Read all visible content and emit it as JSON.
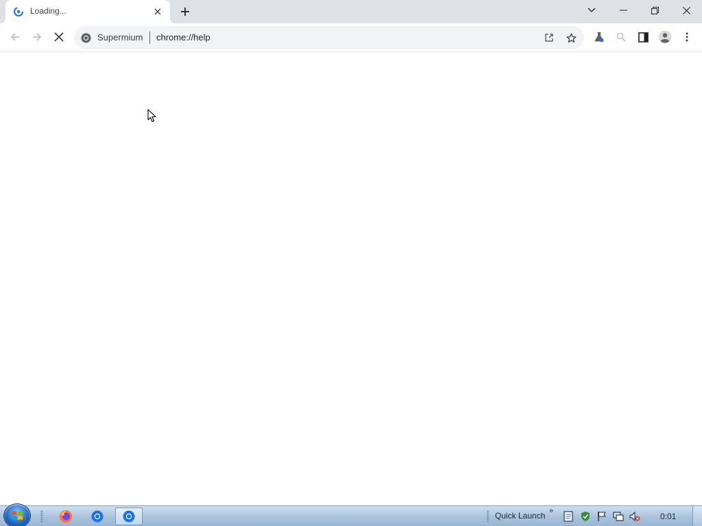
{
  "browser": {
    "tab": {
      "title": "Loading...",
      "favicon": "chromium-loading-icon",
      "close_icon": "close-icon"
    },
    "new_tab_icon": "plus-icon",
    "window_controls": [
      "chevron-down-icon",
      "minimize-icon",
      "restore-icon",
      "close-icon"
    ],
    "toolbar": {
      "back_icon": "arrow-left-icon",
      "forward_icon": "arrow-right-icon",
      "stop_icon": "stop-loading-icon"
    },
    "omnibox": {
      "site_chip": "Supermium",
      "url": "chrome://help",
      "actions": [
        "share-icon",
        "bookmark-star-icon"
      ]
    },
    "extensions": [
      "labs-flask-icon",
      "search-icon",
      "side-panel-icon",
      "profile-icon",
      "menu-kebab-icon"
    ]
  },
  "taskbar": {
    "start_icon": "windows-orb-icon",
    "apps": [
      "firefox-icon",
      "chrome-icon",
      "chrome-icon"
    ],
    "quick_launch_label": "Quick Launch",
    "quick_launch_chevron": "»",
    "tray_icons": [
      "notepad-icon",
      "security-shield-icon",
      "action-center-flag-icon",
      "network-icon",
      "volume-muted-icon"
    ],
    "clock": "0:01"
  },
  "colors": {
    "tabstrip_bg": "#dee1e6",
    "omnibox_bg": "#f1f3f4",
    "taskbar_bg": "#a9c3dd",
    "icon_gray": "#5f6368"
  }
}
